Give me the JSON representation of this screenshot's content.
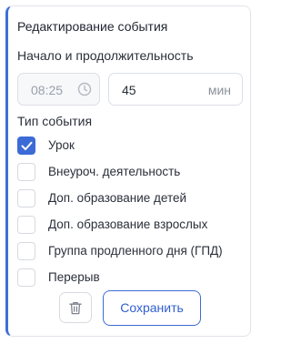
{
  "title": "Редактирование события",
  "start_section": {
    "label": "Начало и продолжительность",
    "time": {
      "value": "08:25",
      "icon": "clock-icon"
    },
    "duration": {
      "value": "45",
      "unit": "мин"
    }
  },
  "type_section": {
    "label": "Тип события",
    "options": [
      {
        "label": "Урок",
        "checked": true
      },
      {
        "label": "Внеуроч. деятельность",
        "checked": false
      },
      {
        "label": "Доп. образование детей",
        "checked": false
      },
      {
        "label": "Доп. образование взрослых",
        "checked": false
      },
      {
        "label": "Группа продленного дня (ГПД)",
        "checked": false
      },
      {
        "label": "Перерыв",
        "checked": false
      }
    ]
  },
  "actions": {
    "delete_icon": "trash-icon",
    "save_label": "Сохранить"
  },
  "colors": {
    "accent": "#3d6bd6",
    "accent_border": "#3f6fd8"
  }
}
